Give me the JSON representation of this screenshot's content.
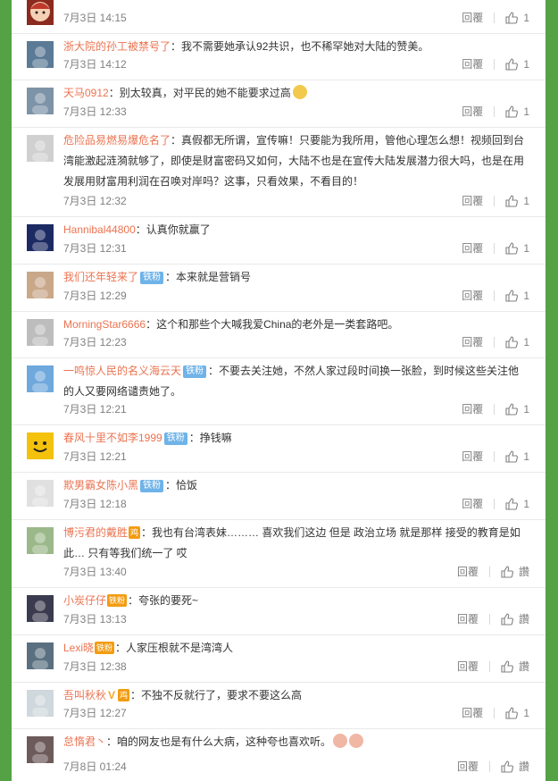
{
  "comments": [
    {
      "user": "",
      "badge": "",
      "text": "",
      "time": "7月3日 14:15",
      "reply": "回覆",
      "likes": "1",
      "avatar_color": "#8b2a1f",
      "avatar_icon": "cartoon-avatar-icon"
    },
    {
      "user": "浙大院的孙工被禁号了",
      "badge": "",
      "text": "：我不需要她承认92共识，也不稀罕她对大陆的赞美。",
      "time": "7月3日 14:12",
      "reply": "回覆",
      "likes": "1",
      "avatar_color": "#5b7a96"
    },
    {
      "user": "天马0912",
      "badge": "",
      "text": "：别太较真，对平民的她不能要求过高",
      "time": "7月3日 12:33",
      "reply": "回覆",
      "likes": "1",
      "avatar_color": "#7d93a7",
      "emoji": "thinking-emoji-icon"
    },
    {
      "user": "危险品易燃易爆危名了",
      "badge": "",
      "text": "：真假都无所谓，宣传嘛！只要能为我所用，管他心理怎么想！视频回到台湾能激起涟漪就够了，即使是财富密码又如何，大陆不也是在宣传大陆发展潜力很大吗，也是在用发展用财富用利润在召唤对岸吗？这事，只看效果，不看目的！",
      "time": "7月3日 12:32",
      "reply": "回覆",
      "likes": "1",
      "avatar_color": "#d0d0d0"
    },
    {
      "user": "Hannibal44800",
      "badge": "",
      "text": "：认真你就赢了",
      "time": "7月3日 12:31",
      "reply": "回覆",
      "likes": "1",
      "avatar_color": "#1c2a63"
    },
    {
      "user": "我们还年轻来了",
      "badge": "铁粉",
      "text": "：本来就是营销号",
      "time": "7月3日 12:29",
      "reply": "回覆",
      "likes": "1",
      "avatar_color": "#c9a88a"
    },
    {
      "user": "MorningStar6666",
      "badge": "",
      "text": "：这个和那些个大喊我爱China的老外是一类套路吧。",
      "time": "7月3日 12:23",
      "reply": "回覆",
      "likes": "1",
      "avatar_color": "#bdbdbd"
    },
    {
      "user": "一鸣惊人民的名义海云天",
      "badge": "铁粉",
      "text": "：不要去关注她，不然人家过段时间换一张脸，到时候这些关注他的人又要网络谴责她了。",
      "time": "7月3日 12:21",
      "reply": "回覆",
      "likes": "1",
      "avatar_color": "#6fa8dc"
    },
    {
      "user": "春风十里不如李1999",
      "badge": "铁粉",
      "text": "：挣钱嘛",
      "time": "7月3日 12:21",
      "reply": "回覆",
      "likes": "1",
      "avatar_color": "#f4c20d",
      "avatar_icon": "smiley-avatar-icon"
    },
    {
      "user": "欺男霸女陈小黑",
      "badge": "铁粉",
      "text": "：恰饭",
      "time": "7月3日 12:18",
      "reply": "回覆",
      "likes": "1",
      "avatar_color": "#e0e0e0"
    },
    {
      "user": "博污君的戴胜",
      "badge": "",
      "vip": "鸡",
      "text": "：我也有台湾表妹……… 喜欢我们这边 但是 政治立场 就是那样 接受的教育是如此… 只有等我们统一了 哎",
      "time": "7月3日 13:40",
      "reply": "回覆",
      "likes": "讚",
      "avatar_color": "#9bb88a"
    },
    {
      "user": "小炭仔仔",
      "badge": "",
      "vip": "铁粉",
      "text": "：夸张的要死~",
      "time": "7月3日 13:13",
      "reply": "回覆",
      "likes": "讚",
      "avatar_color": "#3b3b4f"
    },
    {
      "user": "Lexi晓",
      "badge": "",
      "vip": "铁粉",
      "text": "：人家压根就不是湾湾人",
      "time": "7月3日 12:38",
      "reply": "回覆",
      "likes": "讚",
      "avatar_color": "#5a7080"
    },
    {
      "user": "吾叫秋秋",
      "badge": "",
      "vmark": "V",
      "vip": "鸡",
      "text": "：不独不反就行了，要求不要这么高",
      "time": "7月3日 12:27",
      "reply": "回覆",
      "likes": "1",
      "avatar_color": "#cfd8dc"
    },
    {
      "user": "怠惰君丶",
      "badge": "",
      "text": "：咱的网友也是有什么大病，这种夸也喜欢听。",
      "time": "7月8日 01:24",
      "reply": "回覆",
      "likes": "讚",
      "avatar_color": "#6d5a5a",
      "emoji": "bowing-emoji-icon"
    }
  ]
}
